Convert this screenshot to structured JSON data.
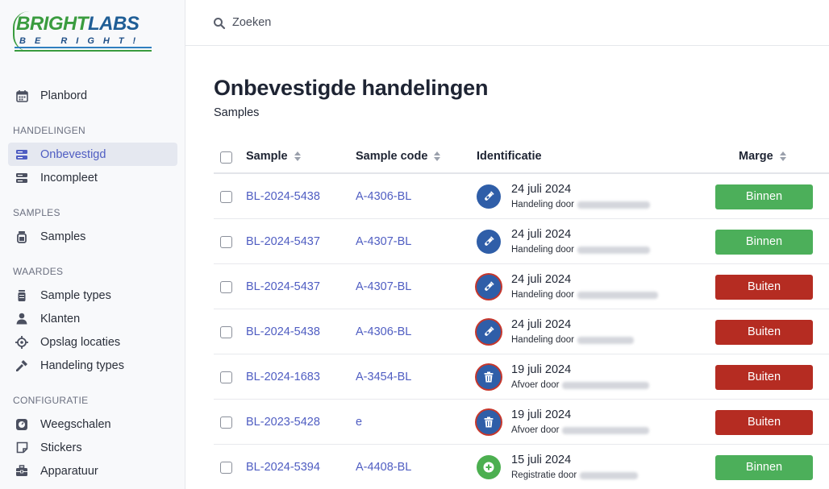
{
  "logo": {
    "text_bright": "BRIGHT",
    "text_labs": "LABS",
    "tagline": "BE RIGHT!"
  },
  "search": {
    "placeholder": "Zoeken"
  },
  "nav": {
    "planbord": "Planbord",
    "sections": [
      {
        "label": "HANDELINGEN",
        "items": [
          {
            "label": "Onbevestigd",
            "icon": "stack-icon",
            "active": true
          },
          {
            "label": "Incompleet",
            "icon": "stack-icon"
          }
        ]
      },
      {
        "label": "SAMPLES",
        "items": [
          {
            "label": "Samples",
            "icon": "jar-icon"
          }
        ]
      },
      {
        "label": "WAARDES",
        "items": [
          {
            "label": "Sample types",
            "icon": "cylinder-icon"
          },
          {
            "label": "Klanten",
            "icon": "user-icon"
          },
          {
            "label": "Opslag locaties",
            "icon": "crosshair-icon"
          },
          {
            "label": "Handeling types",
            "icon": "tool-icon"
          }
        ]
      },
      {
        "label": "CONFIGURATIE",
        "items": [
          {
            "label": "Weegschalen",
            "icon": "scale-icon"
          },
          {
            "label": "Stickers",
            "icon": "sticker-icon"
          },
          {
            "label": "Apparatuur",
            "icon": "toolbox-icon"
          }
        ]
      }
    ]
  },
  "page": {
    "title": "Onbevestigde handelingen",
    "subtitle": "Samples"
  },
  "table": {
    "headers": {
      "sample": "Sample",
      "sample_code": "Sample code",
      "identificatie": "Identificatie",
      "marge": "Marge"
    },
    "rows": [
      {
        "sample": "BL-2024-5438",
        "code": "A-4306-BL",
        "date": "24 juli 2024",
        "by": "Handeling door",
        "icon": "test-tube-icon",
        "style": "blue",
        "marge": "Binnen"
      },
      {
        "sample": "BL-2024-5437",
        "code": "A-4307-BL",
        "date": "24 juli 2024",
        "by": "Handeling door",
        "icon": "test-tube-icon",
        "style": "blue",
        "marge": "Binnen"
      },
      {
        "sample": "BL-2024-5437",
        "code": "A-4307-BL",
        "date": "24 juli 2024",
        "by": "Handeling door",
        "icon": "test-tube-icon",
        "style": "blue-red",
        "marge": "Buiten"
      },
      {
        "sample": "BL-2024-5438",
        "code": "A-4306-BL",
        "date": "24 juli 2024",
        "by": "Handeling door",
        "icon": "test-tube-icon",
        "style": "blue-red",
        "marge": "Buiten"
      },
      {
        "sample": "BL-2024-1683",
        "code": "A-3454-BL",
        "date": "19 juli 2024",
        "by": "Afvoer door",
        "icon": "trash-icon",
        "style": "blue-red",
        "marge": "Buiten"
      },
      {
        "sample": "BL-2023-5428",
        "code": "e",
        "date": "19 juli 2024",
        "by": "Afvoer door",
        "icon": "trash-icon",
        "style": "blue-red",
        "marge": "Buiten"
      },
      {
        "sample": "BL-2024-5394",
        "code": "A-4408-BL",
        "date": "15 juli 2024",
        "by": "Registratie door",
        "icon": "plus-circle-icon",
        "style": "green",
        "marge": "Binnen"
      }
    ]
  },
  "colors": {
    "accent": "#4f5dc2",
    "binnen": "#4caf5a",
    "buiten": "#b52c22",
    "ident_blue": "#2f5ea8",
    "ident_green": "#4caf50"
  }
}
